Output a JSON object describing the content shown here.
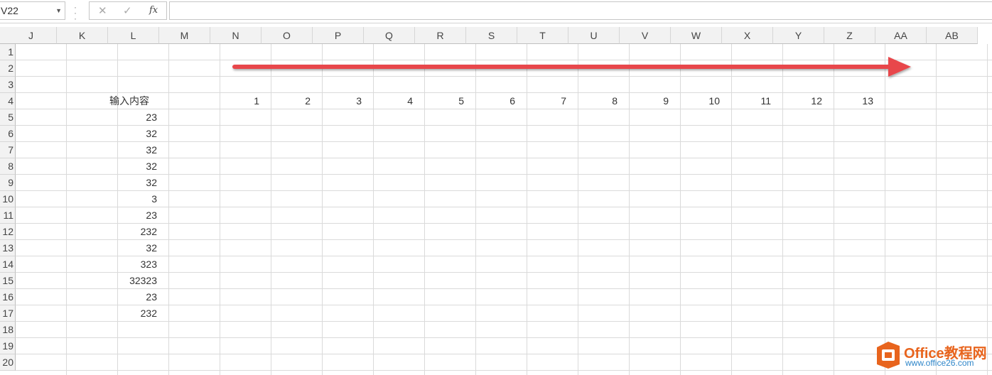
{
  "formula_bar": {
    "name_box": "V22",
    "cancel_glyph": "✕",
    "enter_glyph": "✓",
    "fx_label": "fx",
    "formula_value": ""
  },
  "columns": [
    "J",
    "K",
    "L",
    "M",
    "N",
    "O",
    "P",
    "Q",
    "R",
    "S",
    "T",
    "U",
    "V",
    "W",
    "X",
    "Y",
    "Z",
    "AA",
    "AB"
  ],
  "rows": [
    "1",
    "2",
    "3",
    "4",
    "5",
    "6",
    "7",
    "8",
    "9",
    "10",
    "11",
    "12",
    "13",
    "14",
    "15",
    "16",
    "17",
    "18",
    "19",
    "20"
  ],
  "input_header": "输入内容",
  "input_values": [
    "23",
    "32",
    "32",
    "32",
    "32",
    "3",
    "23",
    "232",
    "32",
    "323",
    "32323",
    "23",
    "232"
  ],
  "sequence": [
    "1",
    "2",
    "3",
    "4",
    "5",
    "6",
    "7",
    "8",
    "9",
    "10",
    "11",
    "12",
    "13"
  ],
  "annotation": {
    "arrow_color": "#e8474b",
    "arrow_direction": "right"
  },
  "watermark": {
    "brand": "Office教程网",
    "url": "www.office26.com",
    "brand_color": "#e8641d",
    "url_color": "#2f86c9"
  }
}
